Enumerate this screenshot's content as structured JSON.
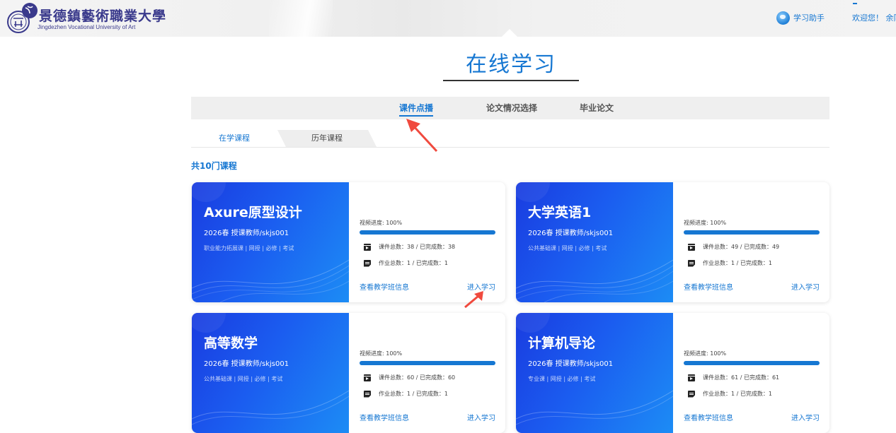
{
  "header": {
    "logo_cn": "景德鎮藝術職業大學",
    "logo_en": "Jingdezhen Vocational University of Art",
    "helper_label": "学习助手",
    "welcome": "欢迎您！ 余同"
  },
  "page": {
    "title": "在线学习"
  },
  "main_tabs": [
    {
      "label": "课件点播",
      "active": true
    },
    {
      "label": "论文情况选择",
      "active": false
    },
    {
      "label": "毕业论文",
      "active": false
    }
  ],
  "sub_tabs": [
    {
      "label": "在学课程",
      "active": true
    },
    {
      "label": "历年课程",
      "active": false
    }
  ],
  "course_count": "共10门课程",
  "courses": [
    {
      "name": "Axure原型设计",
      "term": "2026春  授课教师/skjs001",
      "tags": "职业能力拓展课 | 网授 | 必修 | 考试",
      "progress_label": "视频进度: 100%",
      "progress": 1.0,
      "lessons": "课件总数：38 / 已完成数：38",
      "homework": "作业总数：1 / 已完成数：1",
      "class_link": "查看教学班信息",
      "enter_link": "进入学习"
    },
    {
      "name": "大学英语1",
      "term": "2026春  授课教师/skjs001",
      "tags": "公共基础课 | 网授 | 必修 | 考试",
      "progress_label": "视频进度: 100%",
      "progress": 1.0,
      "lessons": "课件总数：49 / 已完成数：49",
      "homework": "作业总数：1 / 已完成数：1",
      "class_link": "查看教学班信息",
      "enter_link": "进入学习"
    },
    {
      "name": "高等数学",
      "term": "2026春  授课教师/skjs001",
      "tags": "公共基础课 | 网授 | 必修 | 考试",
      "progress_label": "视频进度: 100%",
      "progress": 1.0,
      "lessons": "课件总数：60 / 已完成数：60",
      "homework": "作业总数：1 / 已完成数：1",
      "class_link": "查看教学班信息",
      "enter_link": "进入学习"
    },
    {
      "name": "计算机导论",
      "term": "2026春  授课教师/skjs001",
      "tags": "专业课 | 网授 | 必修 | 考试",
      "progress_label": "视频进度: 100%",
      "progress": 1.0,
      "lessons": "课件总数：61 / 已完成数：61",
      "homework": "作业总数：1 / 已完成数：1",
      "class_link": "查看教学班信息",
      "enter_link": "进入学习"
    }
  ],
  "colors": {
    "accent": "#1677d2",
    "banner_start": "#1a3ce0",
    "banner_end": "#1c8cf5",
    "annotation_arrow": "#f04a3e"
  }
}
